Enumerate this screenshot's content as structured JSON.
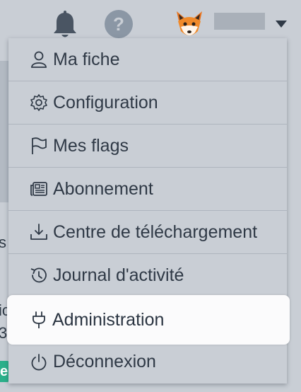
{
  "header": {
    "notifications_icon": "bell-icon",
    "help_icon": "question-circle-icon",
    "help_glyph": "?",
    "avatar_icon": "fox-avatar",
    "menu_toggle_icon": "caret-down-icon"
  },
  "background": {
    "fragment_1": "s",
    "fragment_2": "ic",
    "fragment_3": "3",
    "fragment_4": "e"
  },
  "menu": {
    "items": [
      {
        "label": "Ma fiche",
        "icon": "user-icon"
      },
      {
        "label": "Configuration",
        "icon": "gear-icon"
      },
      {
        "label": "Mes flags",
        "icon": "flag-icon"
      },
      {
        "label": "Abonnement",
        "icon": "newspaper-icon"
      },
      {
        "label": "Centre de téléchargement",
        "icon": "download-icon"
      },
      {
        "label": "Journal d'activité",
        "icon": "history-icon"
      },
      {
        "label": "Administration",
        "icon": "plug-icon",
        "active": true
      },
      {
        "label": "Déconnexion",
        "icon": "power-icon"
      }
    ]
  },
  "colors": {
    "overlay_bg": "#c9ced5",
    "text": "#2f3946",
    "active_bg": "#fbfbfc",
    "accent_green": "#2bb08a"
  }
}
